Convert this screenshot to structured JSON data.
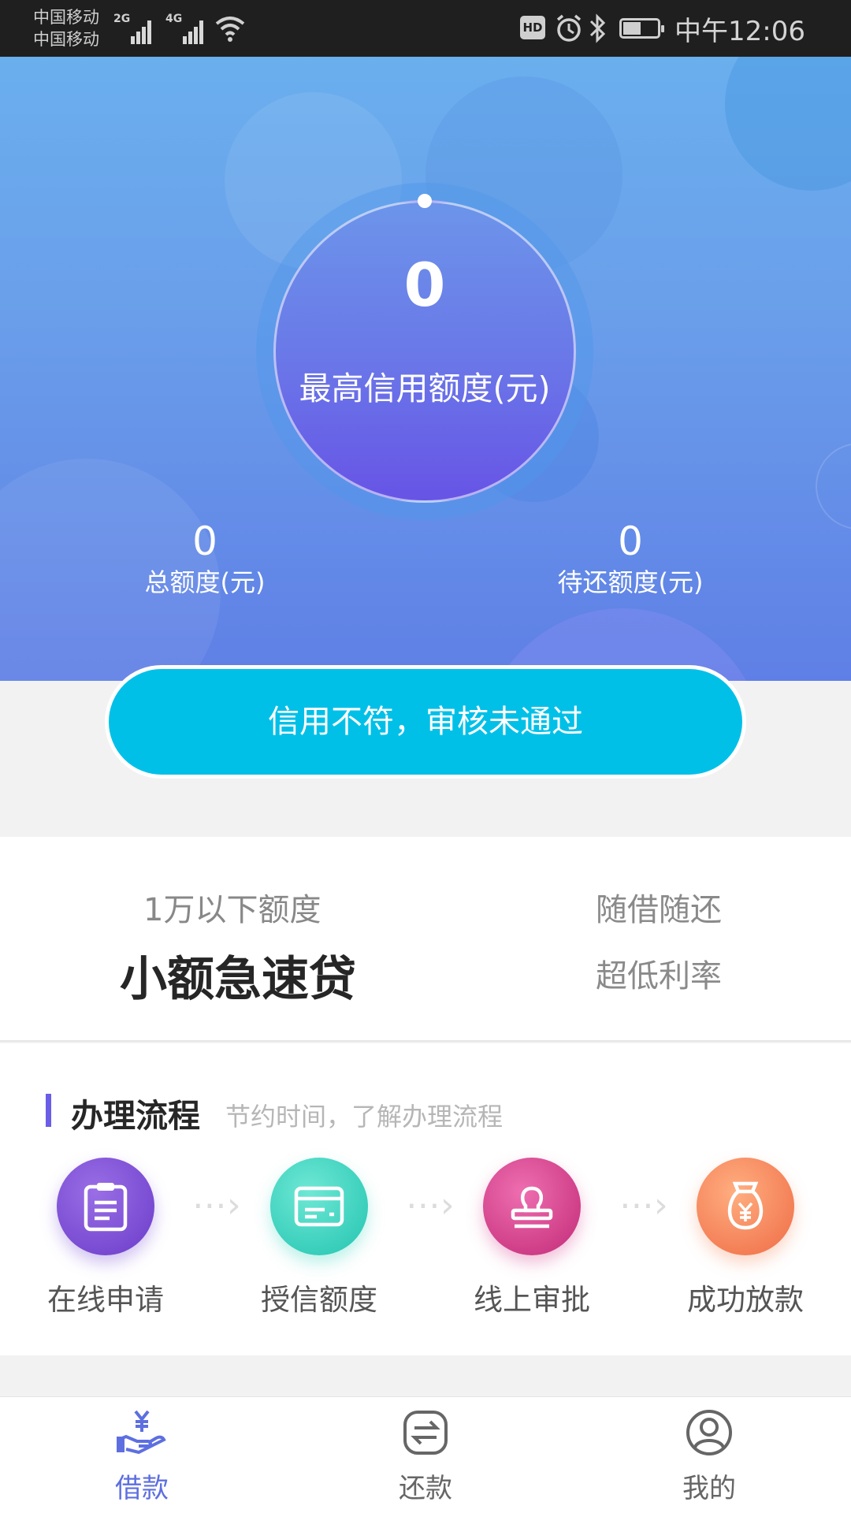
{
  "status_bar": {
    "carrier_1": "中国移动",
    "carrier_2": "中国移动",
    "signal_1_tag": "2G",
    "signal_2_tag": "4G",
    "hd_badge": "HD",
    "time": "中午12:06"
  },
  "hero": {
    "max_credit_value": "0",
    "max_credit_label": "最高信用额度(元)",
    "total_credit_value": "0",
    "total_credit_label": "总额度(元)",
    "pending_repay_value": "0",
    "pending_repay_label": "待还额度(元)"
  },
  "status_button": {
    "label": "信用不符，审核未通过"
  },
  "product": {
    "subtitle": "1万以下额度",
    "title": "小额急速贷",
    "feature_1": "随借随还",
    "feature_2": "超低利率"
  },
  "process": {
    "title": "办理流程",
    "subtitle": "节约时间，了解办理流程",
    "steps": [
      {
        "label": "在线申请",
        "icon": "clipboard-icon"
      },
      {
        "label": "授信额度",
        "icon": "credit-card-icon"
      },
      {
        "label": "线上审批",
        "icon": "stamp-icon"
      },
      {
        "label": "成功放款",
        "icon": "money-bag-icon"
      }
    ]
  },
  "tabbar": {
    "tabs": [
      {
        "label": "借款",
        "icon": "loan-icon",
        "active": true
      },
      {
        "label": "还款",
        "icon": "repay-icon",
        "active": false
      },
      {
        "label": "我的",
        "icon": "profile-icon",
        "active": false
      }
    ]
  },
  "colors": {
    "accent": "#5d6fe0",
    "status_button": "#00c0e8",
    "step_1": "#7b4fd6",
    "step_2": "#3fd6c1",
    "step_3": "#d6448e",
    "step_4": "#f5895e"
  }
}
